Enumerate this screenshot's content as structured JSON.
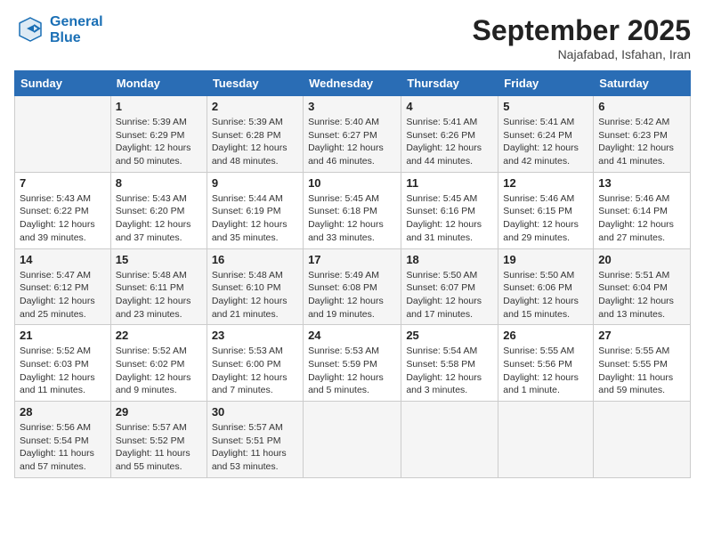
{
  "logo": {
    "line1": "General",
    "line2": "Blue"
  },
  "title": "September 2025",
  "location": "Najafabad, Isfahan, Iran",
  "days_of_week": [
    "Sunday",
    "Monday",
    "Tuesday",
    "Wednesday",
    "Thursday",
    "Friday",
    "Saturday"
  ],
  "weeks": [
    [
      {
        "day": "",
        "info": ""
      },
      {
        "day": "1",
        "info": "Sunrise: 5:39 AM\nSunset: 6:29 PM\nDaylight: 12 hours\nand 50 minutes."
      },
      {
        "day": "2",
        "info": "Sunrise: 5:39 AM\nSunset: 6:28 PM\nDaylight: 12 hours\nand 48 minutes."
      },
      {
        "day": "3",
        "info": "Sunrise: 5:40 AM\nSunset: 6:27 PM\nDaylight: 12 hours\nand 46 minutes."
      },
      {
        "day": "4",
        "info": "Sunrise: 5:41 AM\nSunset: 6:26 PM\nDaylight: 12 hours\nand 44 minutes."
      },
      {
        "day": "5",
        "info": "Sunrise: 5:41 AM\nSunset: 6:24 PM\nDaylight: 12 hours\nand 42 minutes."
      },
      {
        "day": "6",
        "info": "Sunrise: 5:42 AM\nSunset: 6:23 PM\nDaylight: 12 hours\nand 41 minutes."
      }
    ],
    [
      {
        "day": "7",
        "info": "Sunrise: 5:43 AM\nSunset: 6:22 PM\nDaylight: 12 hours\nand 39 minutes."
      },
      {
        "day": "8",
        "info": "Sunrise: 5:43 AM\nSunset: 6:20 PM\nDaylight: 12 hours\nand 37 minutes."
      },
      {
        "day": "9",
        "info": "Sunrise: 5:44 AM\nSunset: 6:19 PM\nDaylight: 12 hours\nand 35 minutes."
      },
      {
        "day": "10",
        "info": "Sunrise: 5:45 AM\nSunset: 6:18 PM\nDaylight: 12 hours\nand 33 minutes."
      },
      {
        "day": "11",
        "info": "Sunrise: 5:45 AM\nSunset: 6:16 PM\nDaylight: 12 hours\nand 31 minutes."
      },
      {
        "day": "12",
        "info": "Sunrise: 5:46 AM\nSunset: 6:15 PM\nDaylight: 12 hours\nand 29 minutes."
      },
      {
        "day": "13",
        "info": "Sunrise: 5:46 AM\nSunset: 6:14 PM\nDaylight: 12 hours\nand 27 minutes."
      }
    ],
    [
      {
        "day": "14",
        "info": "Sunrise: 5:47 AM\nSunset: 6:12 PM\nDaylight: 12 hours\nand 25 minutes."
      },
      {
        "day": "15",
        "info": "Sunrise: 5:48 AM\nSunset: 6:11 PM\nDaylight: 12 hours\nand 23 minutes."
      },
      {
        "day": "16",
        "info": "Sunrise: 5:48 AM\nSunset: 6:10 PM\nDaylight: 12 hours\nand 21 minutes."
      },
      {
        "day": "17",
        "info": "Sunrise: 5:49 AM\nSunset: 6:08 PM\nDaylight: 12 hours\nand 19 minutes."
      },
      {
        "day": "18",
        "info": "Sunrise: 5:50 AM\nSunset: 6:07 PM\nDaylight: 12 hours\nand 17 minutes."
      },
      {
        "day": "19",
        "info": "Sunrise: 5:50 AM\nSunset: 6:06 PM\nDaylight: 12 hours\nand 15 minutes."
      },
      {
        "day": "20",
        "info": "Sunrise: 5:51 AM\nSunset: 6:04 PM\nDaylight: 12 hours\nand 13 minutes."
      }
    ],
    [
      {
        "day": "21",
        "info": "Sunrise: 5:52 AM\nSunset: 6:03 PM\nDaylight: 12 hours\nand 11 minutes."
      },
      {
        "day": "22",
        "info": "Sunrise: 5:52 AM\nSunset: 6:02 PM\nDaylight: 12 hours\nand 9 minutes."
      },
      {
        "day": "23",
        "info": "Sunrise: 5:53 AM\nSunset: 6:00 PM\nDaylight: 12 hours\nand 7 minutes."
      },
      {
        "day": "24",
        "info": "Sunrise: 5:53 AM\nSunset: 5:59 PM\nDaylight: 12 hours\nand 5 minutes."
      },
      {
        "day": "25",
        "info": "Sunrise: 5:54 AM\nSunset: 5:58 PM\nDaylight: 12 hours\nand 3 minutes."
      },
      {
        "day": "26",
        "info": "Sunrise: 5:55 AM\nSunset: 5:56 PM\nDaylight: 12 hours\nand 1 minute."
      },
      {
        "day": "27",
        "info": "Sunrise: 5:55 AM\nSunset: 5:55 PM\nDaylight: 11 hours\nand 59 minutes."
      }
    ],
    [
      {
        "day": "28",
        "info": "Sunrise: 5:56 AM\nSunset: 5:54 PM\nDaylight: 11 hours\nand 57 minutes."
      },
      {
        "day": "29",
        "info": "Sunrise: 5:57 AM\nSunset: 5:52 PM\nDaylight: 11 hours\nand 55 minutes."
      },
      {
        "day": "30",
        "info": "Sunrise: 5:57 AM\nSunset: 5:51 PM\nDaylight: 11 hours\nand 53 minutes."
      },
      {
        "day": "",
        "info": ""
      },
      {
        "day": "",
        "info": ""
      },
      {
        "day": "",
        "info": ""
      },
      {
        "day": "",
        "info": ""
      }
    ]
  ]
}
